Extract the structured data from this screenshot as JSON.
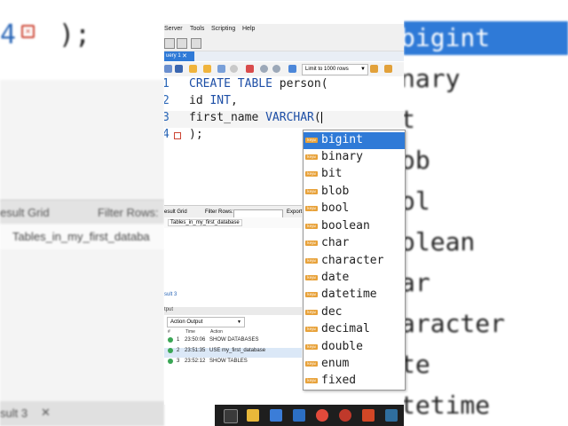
{
  "background": {
    "left_line_number": "4",
    "left_close": ");",
    "left_result_grid": "esult Grid",
    "left_filter": "Filter Rows:",
    "left_table": "Tables_in_my_first_databa",
    "left_result3": "sult 3",
    "right_words": [
      "bigint",
      "nary",
      "t",
      "ob",
      "ol",
      "olean",
      "ar",
      "aracter",
      "te",
      "tetime"
    ]
  },
  "menu": [
    "Server",
    "Tools",
    "Scripting",
    "Help"
  ],
  "query_tab": {
    "label": "uery 1"
  },
  "toolbar": {
    "limit_select": "Limit to 1000 rows"
  },
  "editor": {
    "lines": [
      {
        "num": "1",
        "kw": "CREATE TABLE",
        "rest": " person("
      },
      {
        "num": "2",
        "pre": "id ",
        "kw": "INT",
        "rest": ","
      },
      {
        "num": "3",
        "pre": "first_name ",
        "kw": "VARCHAR",
        "rest": "("
      },
      {
        "num": "4",
        "rest": ");"
      }
    ]
  },
  "result_bar": {
    "grid_label": "esult Grid",
    "filter_label": "Filter Rows:",
    "export": "Export"
  },
  "grid": {
    "header": "Tables_in_my_first_database"
  },
  "result_tab": "sult 3",
  "output": {
    "title": "tput",
    "select": "Action Output",
    "columns": {
      "num": "#",
      "time": "Time",
      "action": "Action"
    },
    "rows": [
      {
        "num": "1",
        "time": "23:50:06",
        "action": "SHOW DATABASES"
      },
      {
        "num": "2",
        "time": "23:51:35",
        "action": "USE my_first_database"
      },
      {
        "num": "3",
        "time": "23:52:12",
        "action": "SHOW TABLES"
      }
    ]
  },
  "autocomplete": {
    "badge": "keyw",
    "items": [
      "bigint",
      "binary",
      "bit",
      "blob",
      "bool",
      "boolean",
      "char",
      "character",
      "date",
      "datetime",
      "dec",
      "decimal",
      "double",
      "enum",
      "fixed"
    ]
  },
  "colors": {
    "selection": "#2f7ad7",
    "keyword": "#1e4fa6",
    "badge": "#e8a23a"
  }
}
